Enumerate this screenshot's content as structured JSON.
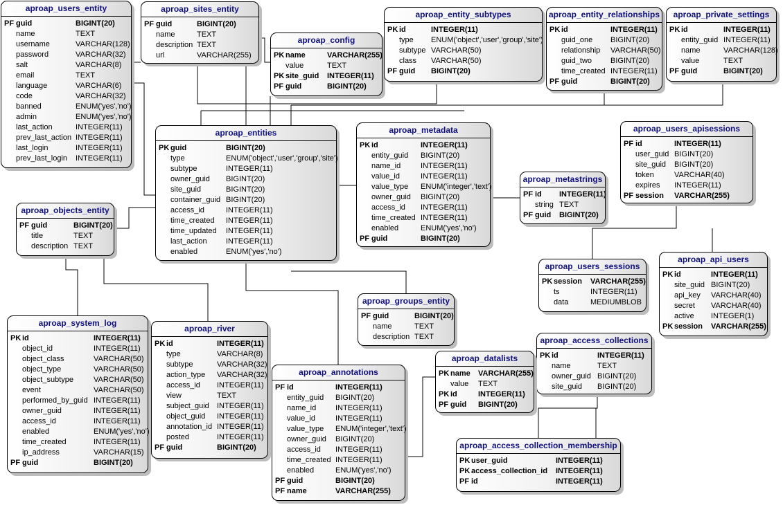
{
  "tables": [
    {
      "id": "users_entity",
      "name": "aproap_users_entity",
      "columns": [
        {
          "key": "PF",
          "name": "guid",
          "type": "BIGINT(20)"
        },
        {
          "key": "",
          "name": "name",
          "type": "TEXT"
        },
        {
          "key": "",
          "name": "username",
          "type": "VARCHAR(128)"
        },
        {
          "key": "",
          "name": "password",
          "type": "VARCHAR(32)"
        },
        {
          "key": "",
          "name": "salt",
          "type": "VARCHAR(8)"
        },
        {
          "key": "",
          "name": "email",
          "type": "TEXT"
        },
        {
          "key": "",
          "name": "language",
          "type": "VARCHAR(6)"
        },
        {
          "key": "",
          "name": "code",
          "type": "VARCHAR(32)"
        },
        {
          "key": "",
          "name": "banned",
          "type": "ENUM('yes','no')"
        },
        {
          "key": "",
          "name": "admin",
          "type": "ENUM('yes','no')"
        },
        {
          "key": "",
          "name": "last_action",
          "type": "INTEGER(11)"
        },
        {
          "key": "",
          "name": "prev_last_action",
          "type": "INTEGER(11)"
        },
        {
          "key": "",
          "name": "last_login",
          "type": "INTEGER(11)"
        },
        {
          "key": "",
          "name": "prev_last_login",
          "type": "INTEGER(11)"
        }
      ]
    },
    {
      "id": "sites_entity",
      "name": "aproap_sites_entity",
      "columns": [
        {
          "key": "PF",
          "name": "guid",
          "type": "BIGINT(20)"
        },
        {
          "key": "",
          "name": "name",
          "type": "TEXT"
        },
        {
          "key": "",
          "name": "description",
          "type": "TEXT"
        },
        {
          "key": "",
          "name": "url",
          "type": "VARCHAR(255)"
        }
      ]
    },
    {
      "id": "config",
      "name": "aproap_config",
      "columns": [
        {
          "key": "PK",
          "name": "name",
          "type": "VARCHAR(255)"
        },
        {
          "key": "",
          "name": "value",
          "type": "TEXT"
        },
        {
          "key": "PK",
          "name": "site_guid",
          "type": "INTEGER(11)"
        },
        {
          "key": "PF",
          "name": "guid",
          "type": "BIGINT(20)"
        }
      ]
    },
    {
      "id": "entity_subtypes",
      "name": "aproap_entity_subtypes",
      "columns": [
        {
          "key": "PK",
          "name": "id",
          "type": "INTEGER(11)"
        },
        {
          "key": "",
          "name": "type",
          "type": "ENUM('object','user','group','site')"
        },
        {
          "key": "",
          "name": "subtype",
          "type": "VARCHAR(50)"
        },
        {
          "key": "",
          "name": "class",
          "type": "VARCHAR(50)"
        },
        {
          "key": "PF",
          "name": "guid",
          "type": "BIGINT(20)"
        }
      ]
    },
    {
      "id": "entity_relationships",
      "name": "aproap_entity_relationships",
      "columns": [
        {
          "key": "PK",
          "name": "id",
          "type": "INTEGER(11)"
        },
        {
          "key": "",
          "name": "guid_one",
          "type": "BIGINT(20)"
        },
        {
          "key": "",
          "name": "relationship",
          "type": "VARCHAR(50)"
        },
        {
          "key": "",
          "name": "guid_two",
          "type": "BIGINT(20)"
        },
        {
          "key": "",
          "name": "time_created",
          "type": "INTEGER(11)"
        },
        {
          "key": "PF",
          "name": "guid",
          "type": "BIGINT(20)"
        }
      ]
    },
    {
      "id": "private_settings",
      "name": "aproap_private_settings",
      "columns": [
        {
          "key": "PK",
          "name": "id",
          "type": "INTEGER(11)"
        },
        {
          "key": "",
          "name": "entity_guid",
          "type": "INTEGER(11)"
        },
        {
          "key": "",
          "name": "name",
          "type": "VARCHAR(128)"
        },
        {
          "key": "",
          "name": "value",
          "type": "TEXT"
        },
        {
          "key": "PF",
          "name": "guid",
          "type": "BIGINT(20)"
        }
      ]
    },
    {
      "id": "entities",
      "name": "aproap_entities",
      "columns": [
        {
          "key": "PK",
          "name": "guid",
          "type": "BIGINT(20)"
        },
        {
          "key": "",
          "name": "type",
          "type": "ENUM('object','user','group','site')"
        },
        {
          "key": "",
          "name": "subtype",
          "type": "INTEGER(11)"
        },
        {
          "key": "",
          "name": "owner_guid",
          "type": "BIGINT(20)"
        },
        {
          "key": "",
          "name": "site_guid",
          "type": "BIGINT(20)"
        },
        {
          "key": "",
          "name": "container_guid",
          "type": "BIGINT(20)"
        },
        {
          "key": "",
          "name": "access_id",
          "type": "INTEGER(11)"
        },
        {
          "key": "",
          "name": "time_created",
          "type": "INTEGER(11)"
        },
        {
          "key": "",
          "name": "time_updated",
          "type": "INTEGER(11)"
        },
        {
          "key": "",
          "name": "last_action",
          "type": "INTEGER(11)"
        },
        {
          "key": "",
          "name": "enabled",
          "type": "ENUM('yes','no')"
        }
      ]
    },
    {
      "id": "metadata",
      "name": "aproap_metadata",
      "columns": [
        {
          "key": "PK",
          "name": "id",
          "type": "INTEGER(11)"
        },
        {
          "key": "",
          "name": "entity_guid",
          "type": "BIGINT(20)"
        },
        {
          "key": "",
          "name": "name_id",
          "type": "INTEGER(11)"
        },
        {
          "key": "",
          "name": "value_id",
          "type": "INTEGER(11)"
        },
        {
          "key": "",
          "name": "value_type",
          "type": "ENUM('integer','text')"
        },
        {
          "key": "",
          "name": "owner_guid",
          "type": "BIGINT(20)"
        },
        {
          "key": "",
          "name": "access_id",
          "type": "INTEGER(11)"
        },
        {
          "key": "",
          "name": "time_created",
          "type": "INTEGER(11)"
        },
        {
          "key": "",
          "name": "enabled",
          "type": "ENUM('yes','no')"
        },
        {
          "key": "PF",
          "name": "guid",
          "type": "BIGINT(20)"
        }
      ]
    },
    {
      "id": "metastrings",
      "name": "aproap_metastrings",
      "columns": [
        {
          "key": "PF",
          "name": "id",
          "type": "INTEGER(11)"
        },
        {
          "key": "",
          "name": "string",
          "type": "TEXT"
        },
        {
          "key": "PF",
          "name": "guid",
          "type": "BIGINT(20)"
        }
      ]
    },
    {
      "id": "users_apisessions",
      "name": "aproap_users_apisessions",
      "columns": [
        {
          "key": "PF",
          "name": "id",
          "type": "INTEGER(11)"
        },
        {
          "key": "",
          "name": "user_guid",
          "type": "BIGINT(20)"
        },
        {
          "key": "",
          "name": "site_guid",
          "type": "BIGINT(20)"
        },
        {
          "key": "",
          "name": "token",
          "type": "VARCHAR(40)"
        },
        {
          "key": "",
          "name": "expires",
          "type": "INTEGER(11)"
        },
        {
          "key": "PF",
          "name": "session",
          "type": "VARCHAR(255)"
        }
      ]
    },
    {
      "id": "objects_entity",
      "name": "aproap_objects_entity",
      "columns": [
        {
          "key": "PF",
          "name": "guid",
          "type": "BIGINT(20)"
        },
        {
          "key": "",
          "name": "title",
          "type": "TEXT"
        },
        {
          "key": "",
          "name": "description",
          "type": "TEXT"
        }
      ]
    },
    {
      "id": "users_sessions",
      "name": "aproap_users_sessions",
      "columns": [
        {
          "key": "PK",
          "name": "session",
          "type": "VARCHAR(255)"
        },
        {
          "key": "",
          "name": "ts",
          "type": "INTEGER(11)"
        },
        {
          "key": "",
          "name": "data",
          "type": "MEDIUMBLOB"
        }
      ]
    },
    {
      "id": "api_users",
      "name": "aproap_api_users",
      "columns": [
        {
          "key": "PK",
          "name": "id",
          "type": "INTEGER(11)"
        },
        {
          "key": "",
          "name": "site_guid",
          "type": "BIGINT(20)"
        },
        {
          "key": "",
          "name": "api_key",
          "type": "VARCHAR(40)"
        },
        {
          "key": "",
          "name": "secret",
          "type": "VARCHAR(40)"
        },
        {
          "key": "",
          "name": "active",
          "type": "INTEGER(1)"
        },
        {
          "key": "PK",
          "name": "session",
          "type": "VARCHAR(255)"
        }
      ]
    },
    {
      "id": "groups_entity",
      "name": "aproap_groups_entity",
      "columns": [
        {
          "key": "PF",
          "name": "guid",
          "type": "BIGINT(20)"
        },
        {
          "key": "",
          "name": "name",
          "type": "TEXT"
        },
        {
          "key": "",
          "name": "description",
          "type": "TEXT"
        }
      ]
    },
    {
      "id": "access_collections",
      "name": "aproap_access_collections",
      "columns": [
        {
          "key": "PK",
          "name": "id",
          "type": "INTEGER(11)"
        },
        {
          "key": "",
          "name": "name",
          "type": "TEXT"
        },
        {
          "key": "",
          "name": "owner_guid",
          "type": "BIGINT(20)"
        },
        {
          "key": "",
          "name": "site_guid",
          "type": "BIGINT(20)"
        }
      ]
    },
    {
      "id": "system_log",
      "name": "aproap_system_log",
      "columns": [
        {
          "key": "PK",
          "name": "id",
          "type": "INTEGER(11)"
        },
        {
          "key": "",
          "name": "object_id",
          "type": "INTEGER(11)"
        },
        {
          "key": "",
          "name": "object_class",
          "type": "VARCHAR(50)"
        },
        {
          "key": "",
          "name": "object_type",
          "type": "VARCHAR(50)"
        },
        {
          "key": "",
          "name": "object_subtype",
          "type": "VARCHAR(50)"
        },
        {
          "key": "",
          "name": "event",
          "type": "VARCHAR(50)"
        },
        {
          "key": "",
          "name": "performed_by_guid",
          "type": "INTEGER(11)"
        },
        {
          "key": "",
          "name": "owner_guid",
          "type": "INTEGER(11)"
        },
        {
          "key": "",
          "name": "access_id",
          "type": "INTEGER(11)"
        },
        {
          "key": "",
          "name": "enabled",
          "type": "ENUM('yes','no')"
        },
        {
          "key": "",
          "name": "time_created",
          "type": "INTEGER(11)"
        },
        {
          "key": "",
          "name": "ip_address",
          "type": "VARCHAR(15)"
        },
        {
          "key": "PF",
          "name": "guid",
          "type": "BIGINT(20)"
        }
      ]
    },
    {
      "id": "river",
      "name": "aproap_river",
      "columns": [
        {
          "key": "PK",
          "name": "id",
          "type": "INTEGER(11)"
        },
        {
          "key": "",
          "name": "type",
          "type": "VARCHAR(8)"
        },
        {
          "key": "",
          "name": "subtype",
          "type": "VARCHAR(32)"
        },
        {
          "key": "",
          "name": "action_type",
          "type": "VARCHAR(32)"
        },
        {
          "key": "",
          "name": "access_id",
          "type": "INTEGER(11)"
        },
        {
          "key": "",
          "name": "view",
          "type": "TEXT"
        },
        {
          "key": "",
          "name": "subject_guid",
          "type": "INTEGER(11)"
        },
        {
          "key": "",
          "name": "object_guid",
          "type": "INTEGER(11)"
        },
        {
          "key": "",
          "name": "annotation_id",
          "type": "INTEGER(11)"
        },
        {
          "key": "",
          "name": "posted",
          "type": "INTEGER(11)"
        },
        {
          "key": "PF",
          "name": "guid",
          "type": "BIGINT(20)"
        }
      ]
    },
    {
      "id": "annotations",
      "name": "aproap_annotations",
      "columns": [
        {
          "key": "PF",
          "name": "id",
          "type": "INTEGER(11)"
        },
        {
          "key": "",
          "name": "entity_guid",
          "type": "BIGINT(20)"
        },
        {
          "key": "",
          "name": "name_id",
          "type": "INTEGER(11)"
        },
        {
          "key": "",
          "name": "value_id",
          "type": "INTEGER(11)"
        },
        {
          "key": "",
          "name": "value_type",
          "type": "ENUM('integer','text')"
        },
        {
          "key": "",
          "name": "owner_guid",
          "type": "BIGINT(20)"
        },
        {
          "key": "",
          "name": "access_id",
          "type": "INTEGER(11)"
        },
        {
          "key": "",
          "name": "time_created",
          "type": "INTEGER(11)"
        },
        {
          "key": "",
          "name": "enabled",
          "type": "ENUM('yes','no')"
        },
        {
          "key": "PF",
          "name": "guid",
          "type": "BIGINT(20)"
        },
        {
          "key": "PF",
          "name": "name",
          "type": "VARCHAR(255)"
        }
      ]
    },
    {
      "id": "datalists",
      "name": "aproap_datalists",
      "columns": [
        {
          "key": "PK",
          "name": "name",
          "type": "VARCHAR(255)"
        },
        {
          "key": "",
          "name": "value",
          "type": "TEXT"
        },
        {
          "key": "PK",
          "name": "id",
          "type": "INTEGER(11)"
        },
        {
          "key": "PF",
          "name": "guid",
          "type": "BIGINT(20)"
        }
      ]
    },
    {
      "id": "access_collection_membership",
      "name": "aproap_access_collection_membership",
      "columns": [
        {
          "key": "PK",
          "name": "user_guid",
          "type": "INTEGER(11)"
        },
        {
          "key": "PK",
          "name": "access_collection_id",
          "type": "INTEGER(11)"
        },
        {
          "key": "PF",
          "name": "id",
          "type": "INTEGER(11)"
        }
      ]
    }
  ],
  "colors": {
    "title": "#101080",
    "border": "#000000",
    "shadow": "#bdbdbd"
  }
}
